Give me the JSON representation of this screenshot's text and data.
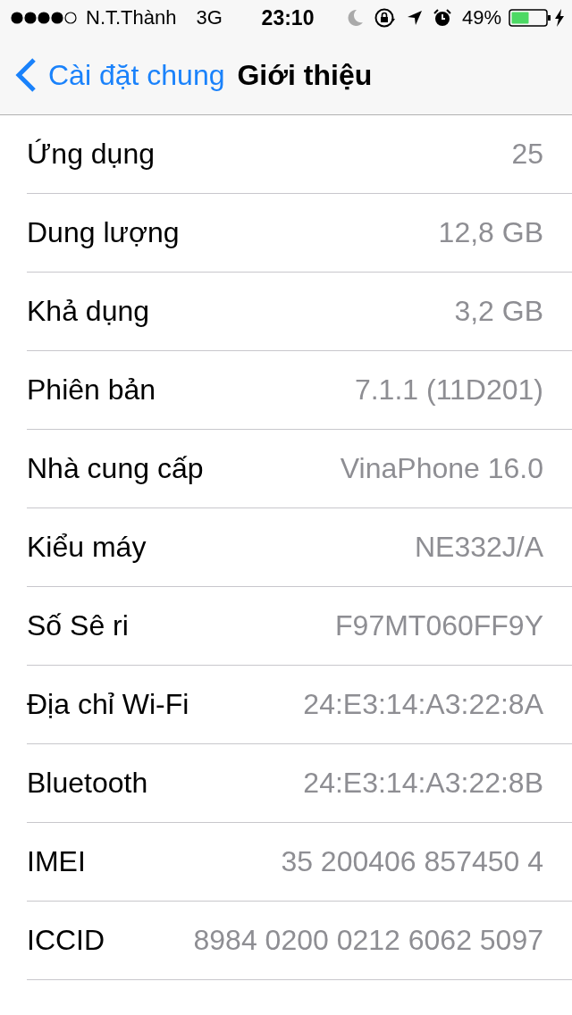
{
  "status_bar": {
    "carrier": "N.T.Thành",
    "network": "3G",
    "time": "23:10",
    "battery": "49%"
  },
  "nav_bar": {
    "back": "Cài đặt chung",
    "title": "Giới thiệu"
  },
  "rows": [
    {
      "label": "Ứng dụng",
      "value": "25"
    },
    {
      "label": "Dung lượng",
      "value": "12,8 GB"
    },
    {
      "label": "Khả dụng",
      "value": "3,2 GB"
    },
    {
      "label": "Phiên bản",
      "value": "7.1.1 (11D201)"
    },
    {
      "label": "Nhà cung cấp",
      "value": "VinaPhone 16.0"
    },
    {
      "label": "Kiểu máy",
      "value": "NE332J/A"
    },
    {
      "label": "Số Sê ri",
      "value": "F97MT060FF9Y"
    },
    {
      "label": "Địa chỉ Wi-Fi",
      "value": "24:E3:14:A3:22:8A"
    },
    {
      "label": "Bluetooth",
      "value": "24:E3:14:A3:22:8B"
    },
    {
      "label": "IMEI",
      "value": "35 200406 857450 4"
    },
    {
      "label": "ICCID",
      "value": "8984 0200 0212 6062 5097"
    }
  ]
}
